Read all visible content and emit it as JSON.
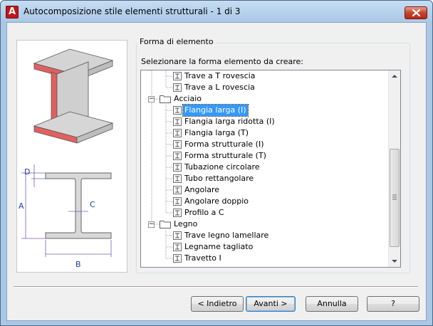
{
  "window": {
    "title": "Autocomposizione stile elementi strutturali - 1 di 3",
    "app_icon_letter": "A"
  },
  "preview": {
    "dimension_labels": {
      "d": "D",
      "a": "A",
      "b": "B",
      "c": "C"
    }
  },
  "group": {
    "legend": "Forma di elemento",
    "prompt": "Selezionare la forma elemento da creare:"
  },
  "tree": {
    "rows": [
      {
        "label": "Trave a T rovescia",
        "type": "leaf",
        "level": 2
      },
      {
        "label": "Trave a L rovescia",
        "type": "leaf",
        "level": 2
      },
      {
        "label": "Acciaio",
        "type": "folder",
        "level": 1,
        "expanded": true
      },
      {
        "label": "Flangia larga (I)",
        "type": "leaf",
        "level": 2,
        "selected": true
      },
      {
        "label": "Flangia larga ridotta (I)",
        "type": "leaf",
        "level": 2
      },
      {
        "label": "Flangia larga (T)",
        "type": "leaf",
        "level": 2
      },
      {
        "label": "Forma strutturale (I)",
        "type": "leaf",
        "level": 2
      },
      {
        "label": "Forma strutturale (T)",
        "type": "leaf",
        "level": 2
      },
      {
        "label": "Tubazione circolare",
        "type": "leaf",
        "level": 2
      },
      {
        "label": "Tubo rettangolare",
        "type": "leaf",
        "level": 2
      },
      {
        "label": "Angolare",
        "type": "leaf",
        "level": 2
      },
      {
        "label": "Angolare doppio",
        "type": "leaf",
        "level": 2
      },
      {
        "label": "Profilo a C",
        "type": "leaf",
        "level": 2
      },
      {
        "label": "Legno",
        "type": "folder",
        "level": 1,
        "expanded": true
      },
      {
        "label": "Trave legno lamellare",
        "type": "leaf",
        "level": 2
      },
      {
        "label": "Legname tagliato",
        "type": "leaf",
        "level": 2
      },
      {
        "label": "Travetto I",
        "type": "leaf",
        "level": 2
      }
    ],
    "expander_minus": "−"
  },
  "buttons": {
    "back": "< Indietro",
    "next": "Avanti >",
    "cancel": "Annulla",
    "help": "?"
  },
  "colors": {
    "selection": "#3399ff",
    "flange_red": "#e06060",
    "accent_blue": "#3c7fb1"
  }
}
